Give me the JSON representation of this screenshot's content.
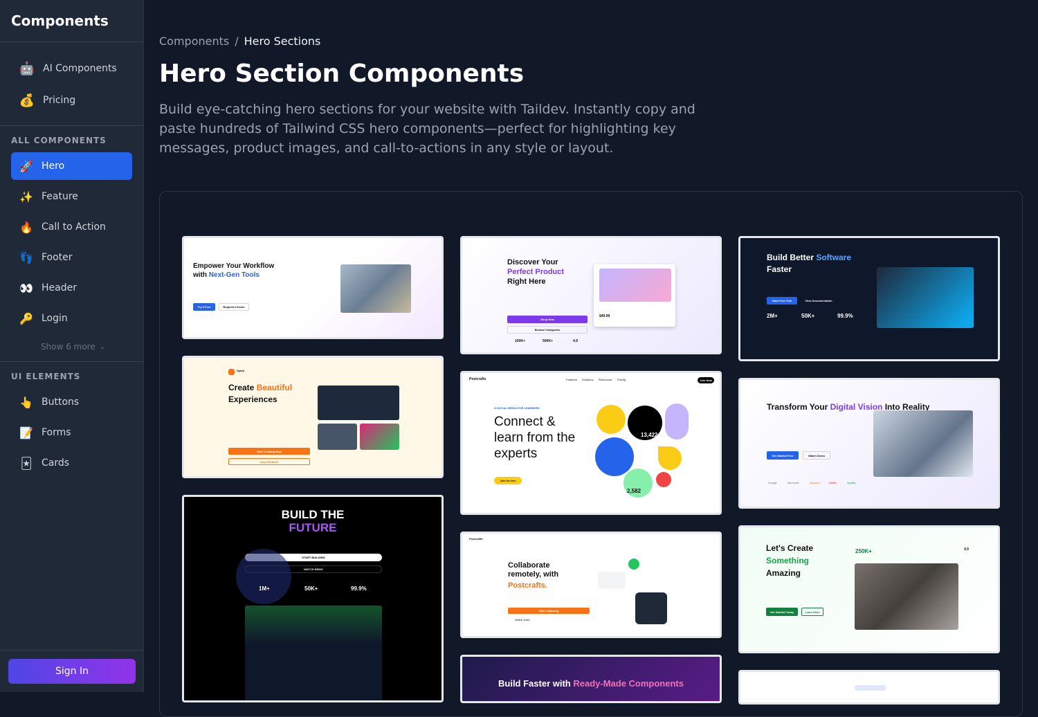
{
  "sidebar": {
    "brand": "Components",
    "top_items": [
      {
        "icon": "robot-icon",
        "glyph": "🤖",
        "label": "AI Components"
      },
      {
        "icon": "money-bag-icon",
        "glyph": "💰",
        "label": "Pricing"
      }
    ],
    "all_components_label": "ALL COMPONENTS",
    "components": [
      {
        "icon": "rocket-icon",
        "glyph": "🚀",
        "label": "Hero",
        "active": true
      },
      {
        "icon": "sparkles-icon",
        "glyph": "✨",
        "label": "Feature"
      },
      {
        "icon": "fire-icon",
        "glyph": "🔥",
        "label": "Call to Action"
      },
      {
        "icon": "footprints-icon",
        "glyph": "👣",
        "label": "Footer"
      },
      {
        "icon": "eyes-icon",
        "glyph": "👀",
        "label": "Header"
      },
      {
        "icon": "key-icon",
        "glyph": "🔑",
        "label": "Login"
      }
    ],
    "show_more": "Show 6 more",
    "ui_elements_label": "UI ELEMENTS",
    "ui_elements": [
      {
        "icon": "pointing-hand-icon",
        "glyph": "👆",
        "label": "Buttons"
      },
      {
        "icon": "memo-icon",
        "glyph": "📝",
        "label": "Forms"
      },
      {
        "icon": "cards-icon",
        "glyph": "🃏",
        "label": "Cards"
      }
    ],
    "sign_in": "Sign In"
  },
  "main": {
    "breadcrumb_root": "Components",
    "breadcrumb_sep": "/",
    "breadcrumb_current": "Hero Sections",
    "title": "Hero Section Components",
    "description": "Build eye-catching hero sections for your website with Taildev. Instantly copy and paste hundreds of Tailwind CSS hero components—perfect for highlighting key messages, product images, and call-to-actions in any style or layout."
  },
  "cards": {
    "c1": {
      "title_a": "Empower Your Workflow",
      "title_b": "with ",
      "title_hl": "Next-Gen Tools",
      "btn1": "Try It Free",
      "btn2": "Request a Demo"
    },
    "c2": {
      "title_a": "Discover Your",
      "title_hl": "Perfect Product",
      "title_c": "Right Here",
      "btn1": "Shop Now",
      "btn2": "Browse Categories",
      "s1": "100K+",
      "s2": "500K+",
      "s3": "4.9",
      "price": "$49.99"
    },
    "c3": {
      "title_a": "Build Better ",
      "title_hl": "Software",
      "title_c": "Faster",
      "btn1": "Start Free Trial",
      "btn2": "View Documentation",
      "s1": "2M+",
      "s2": "50K+",
      "s3": "99.9%"
    },
    "c4": {
      "brand": "Spark",
      "title_a": "Create ",
      "title_hl": "Beautiful",
      "title_c": "Experiences",
      "btn1": "Start Creating Now",
      "btn2": "View Portfolio"
    },
    "c5": {
      "brand": "Postcrafts",
      "nav": [
        "Features",
        "Solutions",
        "Resources",
        "Pricing"
      ],
      "cta": "Join Now",
      "kicker": "A SOCIAL MEDIA FOR LEARNERS",
      "title": "Connect & learn from the experts",
      "btn": "Join for free",
      "n1": "13,422",
      "n2": "2,582"
    },
    "c6": {
      "title_a": "Transform Your ",
      "title_hl": "Digital Vision",
      "title_c": " Into Reality",
      "btn1": "Get Started Free",
      "btn2": "Watch Demo",
      "logos": [
        "Google",
        "Microsoft",
        "Amazon",
        "Netflix",
        "Spotify"
      ]
    },
    "c7": {
      "title_a": "BUILD THE",
      "title_hl": "FUTURE",
      "btn1": "START BUILDING",
      "btn2": "WATCH DEMO",
      "s1": "1M+",
      "s2": "50K+",
      "s3": "99.9%"
    },
    "c8": {
      "brand": "Postcrafts",
      "title_a": "Collaborate remotely, with",
      "title_hl": "Postcrafts.",
      "btn": "Start exploring",
      "link": "Watch video"
    },
    "c9": {
      "title_a": "Let's Create",
      "title_hl": "Something",
      "title_c": "Amazing",
      "btn1": "Get Started Today",
      "btn2": "Learn More",
      "stat": "250K+",
      "rating": "4.9"
    },
    "c10": {
      "title_a": "Build Faster with ",
      "title_hl": "Ready-Made Components"
    }
  }
}
